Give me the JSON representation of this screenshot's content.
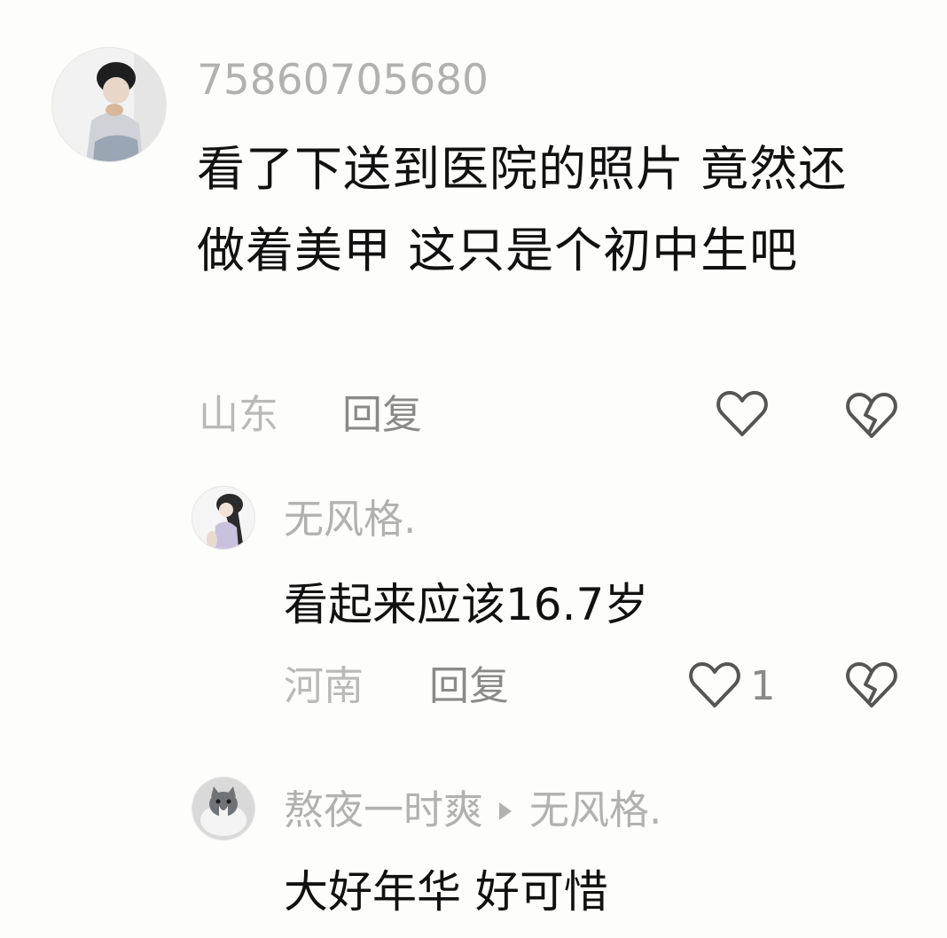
{
  "comments": [
    {
      "username": "75860705680",
      "text": "看了下送到医院的照片 竟然还做着美甲 这只是个初中生吧",
      "location": "山东",
      "reply_label": "回复",
      "likes": "",
      "icons": {
        "like": "heart-outline-icon",
        "dislike": "broken-heart-icon"
      }
    },
    {
      "username": "无风格.",
      "text": "看起来应该16.7岁",
      "location": "河南",
      "reply_label": "回复",
      "likes": "1",
      "icons": {
        "like": "heart-outline-icon",
        "dislike": "broken-heart-icon"
      }
    },
    {
      "username": "熬夜一时爽",
      "reply_to": "无风格.",
      "text": "大好年华 好可惜",
      "icons": {
        "reply_to": "triangle-right-icon"
      }
    }
  ],
  "colors": {
    "username": "#b1b1b1",
    "text": "#111111",
    "location": "#b9b9b9",
    "reply": "#8a8a8a",
    "icon": "#555555",
    "background": "#fdfdfb"
  }
}
